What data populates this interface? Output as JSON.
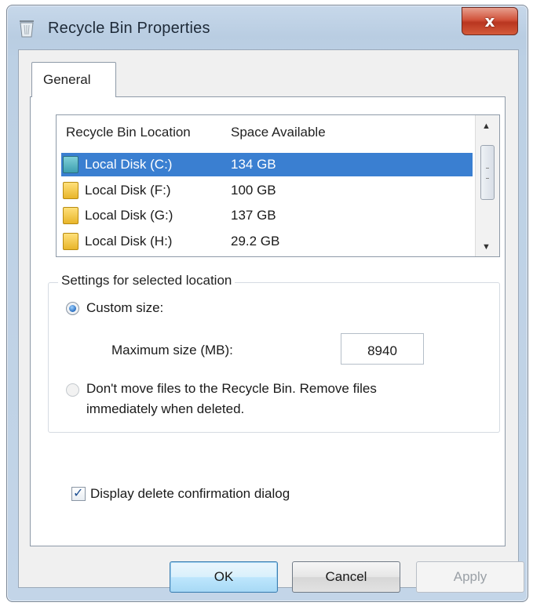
{
  "window": {
    "title": "Recycle Bin Properties",
    "close_label": "x"
  },
  "tabs": [
    {
      "label": "General"
    }
  ],
  "list": {
    "columns": [
      "Recycle Bin Location",
      "Space Available"
    ],
    "rows": [
      {
        "name": "Local Disk (C:)",
        "space": "134 GB",
        "selected": true
      },
      {
        "name": "Local Disk (F:)",
        "space": "100 GB",
        "selected": false
      },
      {
        "name": "Local Disk (G:)",
        "space": "137 GB",
        "selected": false
      },
      {
        "name": "Local Disk (H:)",
        "space": "29.2 GB",
        "selected": false
      }
    ]
  },
  "settings": {
    "group_label": "Settings for selected location",
    "custom_size_label": "Custom size:",
    "max_size_label": "Maximum size (MB):",
    "max_size_value": "8940",
    "no_recycle_line1": "Don't move files to the Recycle Bin. Remove files",
    "no_recycle_line2": "immediately when deleted.",
    "custom_size_selected": true
  },
  "confirm": {
    "label": "Display delete confirmation dialog",
    "checked": true
  },
  "buttons": {
    "ok": "OK",
    "cancel": "Cancel",
    "apply": "Apply"
  },
  "colors": {
    "selection": "#3a7fd1",
    "titlebar": "#bcd0e4",
    "close_button": "#c8452c"
  }
}
